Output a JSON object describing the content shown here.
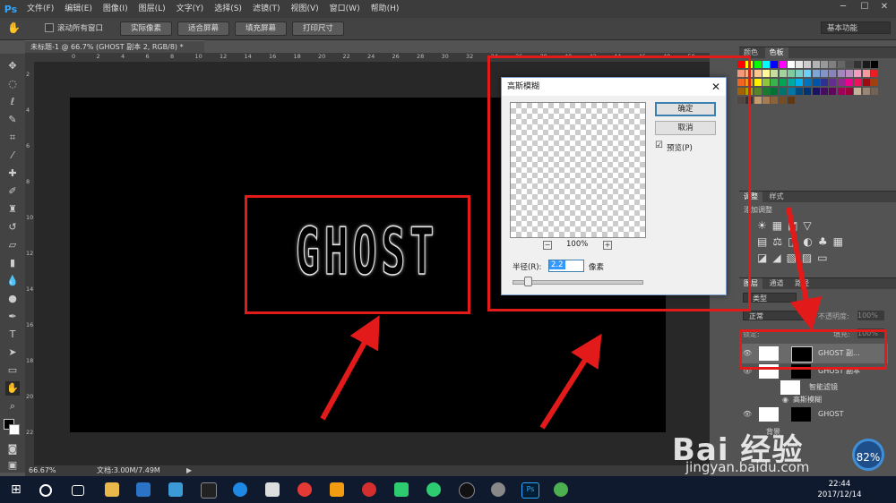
{
  "menubar": {
    "logo": "Ps",
    "items": [
      "文件(F)",
      "编辑(E)",
      "图像(I)",
      "图层(L)",
      "文字(Y)",
      "选择(S)",
      "滤镜(T)",
      "视图(V)",
      "窗口(W)",
      "帮助(H)"
    ]
  },
  "options": {
    "scroll_all": "滚动所有窗口",
    "btn_actual": "实际像素",
    "btn_fit": "适合屏幕",
    "btn_fill": "填充屏幕",
    "btn_print": "打印尺寸",
    "workspace": "基本功能"
  },
  "document": {
    "tab_title": "未标题-1 @ 66.7% (GHOST 副本 2, RGB/8) *",
    "ghost_text": "GHOST",
    "ruler_top": [
      "0",
      "2",
      "4",
      "6",
      "8",
      "10",
      "12",
      "14",
      "16",
      "18",
      "20",
      "22",
      "24",
      "26",
      "28",
      "30",
      "32",
      "34",
      "36",
      "38",
      "40",
      "42",
      "44",
      "46",
      "48",
      "50"
    ],
    "ruler_left": [
      "2",
      "4",
      "6",
      "8",
      "10",
      "12",
      "14",
      "16",
      "18",
      "20",
      "22"
    ]
  },
  "status": {
    "zoom": "66.67%",
    "doc_info": "文档:3.00M/7.49M"
  },
  "dialog": {
    "title": "高斯模糊",
    "ok": "确定",
    "cancel": "取消",
    "preview_label": "预览(P)",
    "preview_checked": "☑",
    "zoom_pct": "100%",
    "zoom_minus": "−",
    "zoom_plus": "+",
    "radius_label": "半径(R):",
    "radius_value": "2.2",
    "unit": "像素"
  },
  "panels": {
    "swatch_tabs": [
      "颜色",
      "色板"
    ],
    "adjust_tabs": [
      "调整",
      "样式"
    ],
    "adjust_hint": "添加调整",
    "layers_tabs": [
      "图层",
      "通道",
      "路径"
    ],
    "kind": "类型",
    "blend": "正常",
    "opacity_label": "不透明度:",
    "opacity_value": "100%",
    "lock_label": "锁定:",
    "fill_label": "填充:",
    "fill_value": "100%",
    "layers": [
      "GHOST 副...",
      "GHOST 副本",
      "智能滤镜",
      "高斯模糊",
      "GHOST",
      "背景"
    ]
  },
  "taskbar": {
    "time": "22:44",
    "date": "2017/12/14"
  },
  "watermark": {
    "brand": "Bai 经验",
    "url": "jingyan.baidu.com",
    "percent": "82%"
  }
}
